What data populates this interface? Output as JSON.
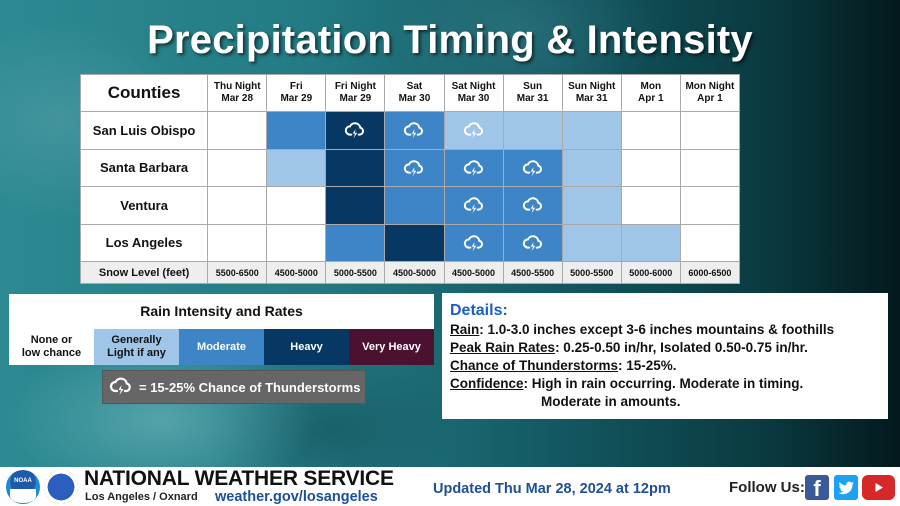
{
  "title": "Precipitation Timing & Intensity",
  "colors": {
    "none": "#ffffff",
    "light": "#9fc5e8",
    "moderate": "#3d85c6",
    "heavy": "#073763",
    "very_heavy": "#4c1130",
    "details_title": "#1c5fc4",
    "footer_blue": "#1f4f96"
  },
  "table": {
    "corner_label": "Counties",
    "periods": [
      {
        "line1": "Thu Night",
        "line2": "Mar 28"
      },
      {
        "line1": "Fri",
        "line2": "Mar 29"
      },
      {
        "line1": "Fri Night",
        "line2": "Mar 29"
      },
      {
        "line1": "Sat",
        "line2": "Mar 30"
      },
      {
        "line1": "Sat Night",
        "line2": "Mar 30"
      },
      {
        "line1": "Sun",
        "line2": "Mar 31"
      },
      {
        "line1": "Sun Night",
        "line2": "Mar 31"
      },
      {
        "line1": "Mon",
        "line2": "Apr 1"
      },
      {
        "line1": "Mon Night",
        "line2": "Apr 1"
      }
    ],
    "rows": [
      {
        "county": "San Luis Obispo",
        "intensity": [
          0,
          2,
          3,
          2,
          1,
          1,
          1,
          0,
          0
        ],
        "thunder": [
          false,
          false,
          true,
          true,
          true,
          false,
          false,
          false,
          false
        ]
      },
      {
        "county": "Santa Barbara",
        "intensity": [
          0,
          1,
          3,
          2,
          2,
          2,
          1,
          0,
          0
        ],
        "thunder": [
          false,
          false,
          false,
          true,
          true,
          true,
          false,
          false,
          false
        ]
      },
      {
        "county": "Ventura",
        "intensity": [
          0,
          0,
          3,
          2,
          2,
          2,
          1,
          0,
          0
        ],
        "thunder": [
          false,
          false,
          false,
          false,
          true,
          true,
          false,
          false,
          false
        ]
      },
      {
        "county": "Los Angeles",
        "intensity": [
          0,
          0,
          2,
          3,
          2,
          2,
          1,
          1,
          0
        ],
        "thunder": [
          false,
          false,
          false,
          false,
          true,
          true,
          false,
          false,
          false
        ]
      }
    ],
    "snow_label": "Snow Level (feet)",
    "snow_levels": [
      "5500-6500",
      "4500-5000",
      "5000-5500",
      "4500-5000",
      "4500-5000",
      "4500-5500",
      "5000-5500",
      "5000-6000",
      "6000-6500"
    ]
  },
  "legend": {
    "title": "Rain Intensity and Rates",
    "levels": [
      {
        "line1": "None or",
        "line2": "low chance"
      },
      {
        "line1": "Generally",
        "line2": "Light if any"
      },
      {
        "line1": "Moderate",
        "line2": ""
      },
      {
        "line1": "Heavy",
        "line2": ""
      },
      {
        "line1": "Very Heavy",
        "line2": ""
      }
    ],
    "thunder_key": "=  15-25% Chance of Thunderstorms",
    "thunder_icon": "cloud-lightning-icon"
  },
  "details": {
    "title": "Details:",
    "rain_label": "Rain",
    "rain_text": ": 1.0-3.0 inches except 3-6 inches mountains & foothills",
    "rates_label": "Peak Rain Rates",
    "rates_text": ": 0.25-0.50 in/hr, Isolated 0.50-0.75 in/hr.",
    "thunder_label": "Chance of Thunderstorms",
    "thunder_text": ": 15-25%.",
    "confidence_label": "Confidence",
    "confidence_text": ": High in rain occurring. Moderate in timing.",
    "confidence_text2": "Moderate in amounts."
  },
  "footer": {
    "noaa_label": "NOAA",
    "agency": "NATIONAL WEATHER SERVICE",
    "office": "Los Angeles / Oxnard",
    "url": "weather.gov/losangeles",
    "updated": "Updated Thu Mar 28, 2024 at 12pm",
    "follow": "Follow Us:",
    "social": [
      "facebook-icon",
      "twitter-icon",
      "youtube-icon"
    ],
    "facebook_glyph": "f"
  }
}
